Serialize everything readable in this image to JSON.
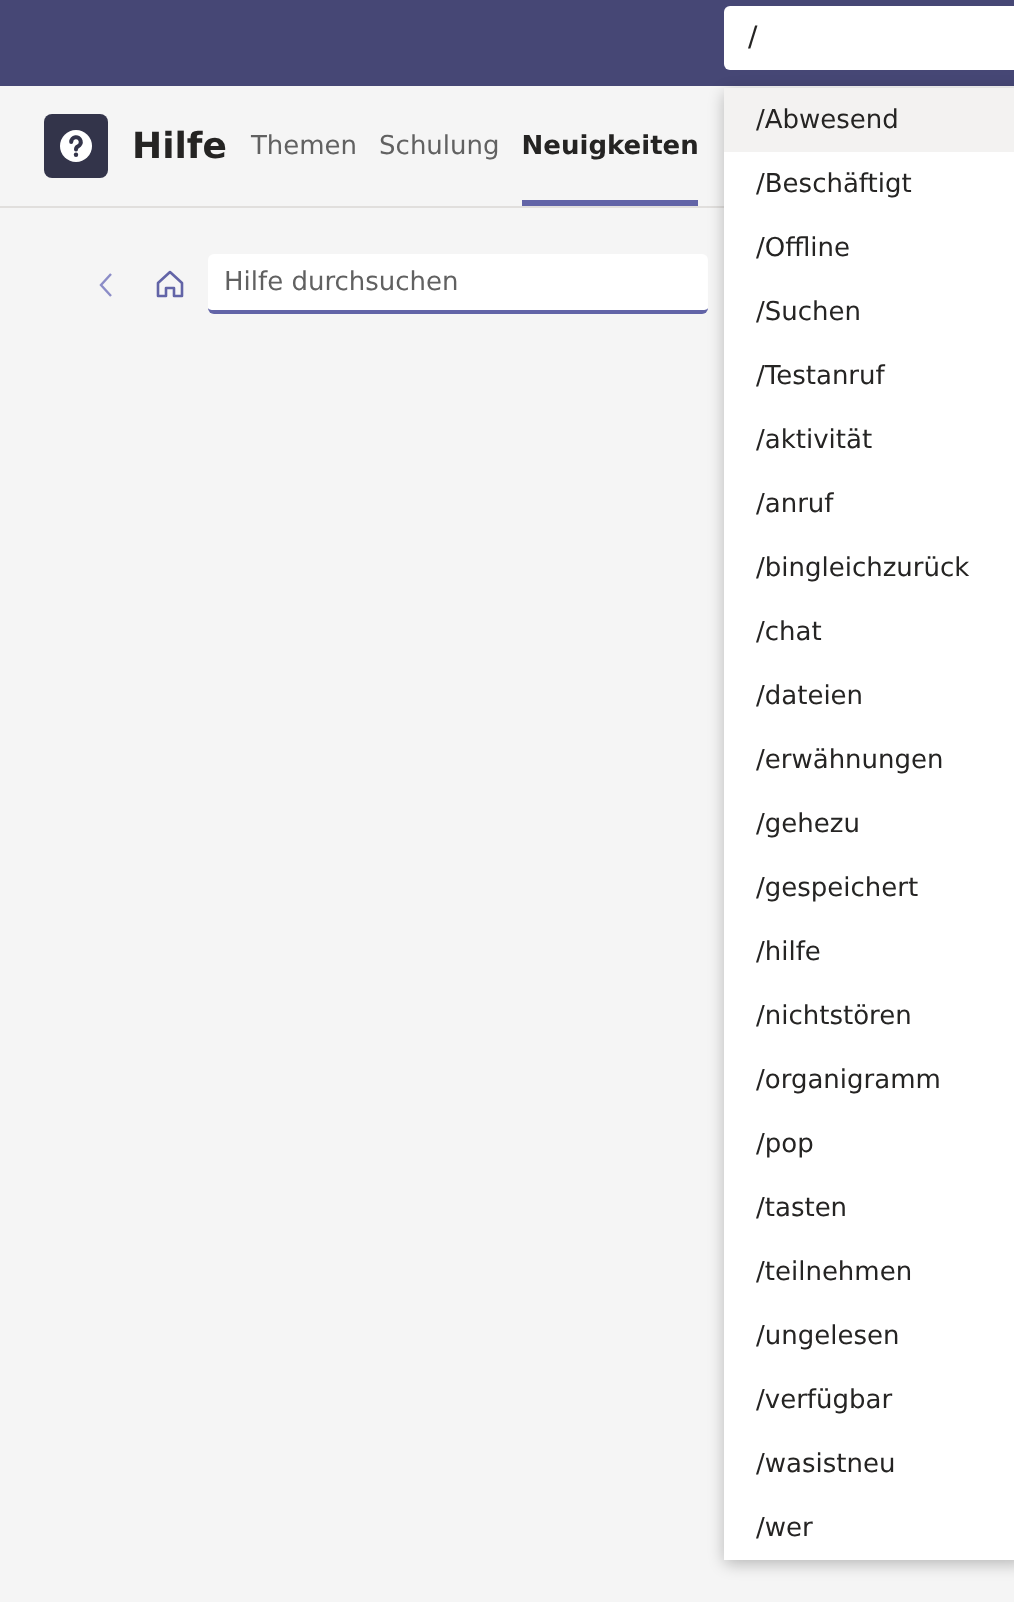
{
  "command_box": {
    "value": "/"
  },
  "app": {
    "title": "Hilfe"
  },
  "tabs": [
    {
      "label": "Themen",
      "selected": false
    },
    {
      "label": "Schulung",
      "selected": false
    },
    {
      "label": "Neuigkeiten",
      "selected": true
    }
  ],
  "search": {
    "placeholder": "Hilfe durchsuchen"
  },
  "suggestions": [
    {
      "label": "/Abwesend",
      "selected": true
    },
    {
      "label": "/Beschäftigt",
      "selected": false
    },
    {
      "label": "/Offline",
      "selected": false
    },
    {
      "label": "/Suchen",
      "selected": false
    },
    {
      "label": "/Testanruf",
      "selected": false
    },
    {
      "label": "/aktivität",
      "selected": false
    },
    {
      "label": "/anruf",
      "selected": false
    },
    {
      "label": "/bingleichzurück",
      "selected": false
    },
    {
      "label": "/chat",
      "selected": false
    },
    {
      "label": "/dateien",
      "selected": false
    },
    {
      "label": "/erwähnungen",
      "selected": false
    },
    {
      "label": "/gehezu",
      "selected": false
    },
    {
      "label": "/gespeichert",
      "selected": false
    },
    {
      "label": "/hilfe",
      "selected": false
    },
    {
      "label": "/nichtstören",
      "selected": false
    },
    {
      "label": "/organigramm",
      "selected": false
    },
    {
      "label": "/pop",
      "selected": false
    },
    {
      "label": "/tasten",
      "selected": false
    },
    {
      "label": "/teilnehmen",
      "selected": false
    },
    {
      "label": "/ungelesen",
      "selected": false
    },
    {
      "label": "/verfügbar",
      "selected": false
    },
    {
      "label": "/wasistneu",
      "selected": false
    },
    {
      "label": "/wer",
      "selected": false
    }
  ]
}
